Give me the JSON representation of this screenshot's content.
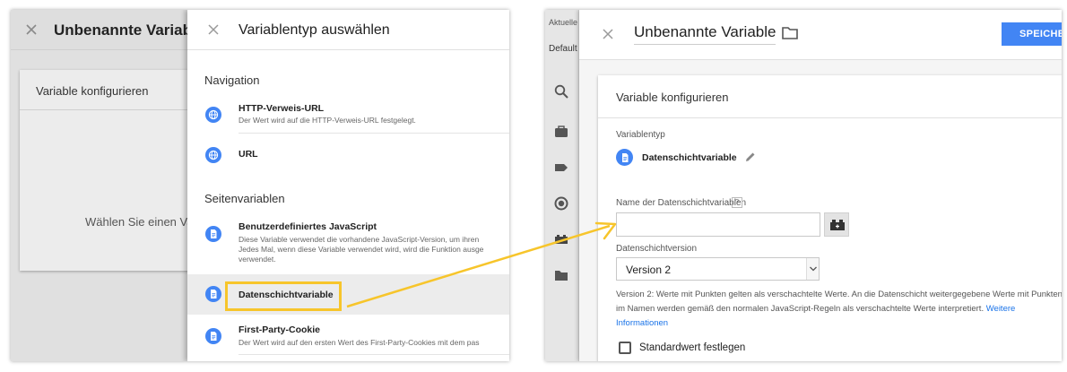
{
  "left": {
    "window_title": "Unbenannte Variable",
    "bg_card_header": "Variable konfigurieren",
    "bg_card_message": "Wählen Sie einen Vari",
    "panel": {
      "title": "Variablentyp auswählen",
      "sections": [
        {
          "heading": "Navigation",
          "items": [
            {
              "name": "HTTP-Verweis-URL",
              "description": [
                "Der Wert wird auf die HTTP-Verweis-URL festgelegt."
              ],
              "icon": "globe-icon"
            },
            {
              "name": "URL",
              "description": [],
              "icon": "globe-icon"
            }
          ]
        },
        {
          "heading": "Seitenvariablen",
          "items": [
            {
              "name": "Benutzerdefiniertes JavaScript",
              "description": [
                "Diese Variable verwendet die vorhandene JavaScript-Version, um ihren",
                "Jedes Mal, wenn diese Variable verwendet wird, wird die Funktion ausge",
                "verwendet."
              ],
              "icon": "document-icon"
            },
            {
              "name": "Datenschichtvariable",
              "description": [],
              "icon": "document-icon",
              "highlighted": true
            },
            {
              "name": "First-Party-Cookie",
              "description": [
                "Der Wert wird auf den ersten Wert des First-Party-Cookies mit dem pas"
              ],
              "icon": "document-icon"
            }
          ]
        }
      ]
    }
  },
  "right": {
    "strip": {
      "tab_current": "Aktuelle",
      "tab_default": "Default"
    },
    "window_title": "Unbenannte Variable",
    "save_label": "SPEICHE",
    "config": {
      "header": "Variable konfigurieren",
      "type_label": "Variablentyp",
      "type_value": "Datenschichtvariable",
      "name_label": "Name der Datenschichtvariablen",
      "help_icon_text": "?",
      "name_value": "",
      "version_label": "Datenschichtversion",
      "version_value": "Version 2",
      "version_help": "Version 2: Werte mit Punkten gelten als verschachtelte Werte. An die Datenschicht weitergegebene Werte mit Punkten im Namen werden gemäß den normalen JavaScript-Regeln als verschachtelte Werte interpretiert.",
      "version_help_link": "Weitere Informationen",
      "default_checkbox_label": "Standardwert festlegen",
      "default_checked": false
    }
  },
  "colors": {
    "accent": "#4285f4",
    "highlight": "#f7c52b"
  }
}
